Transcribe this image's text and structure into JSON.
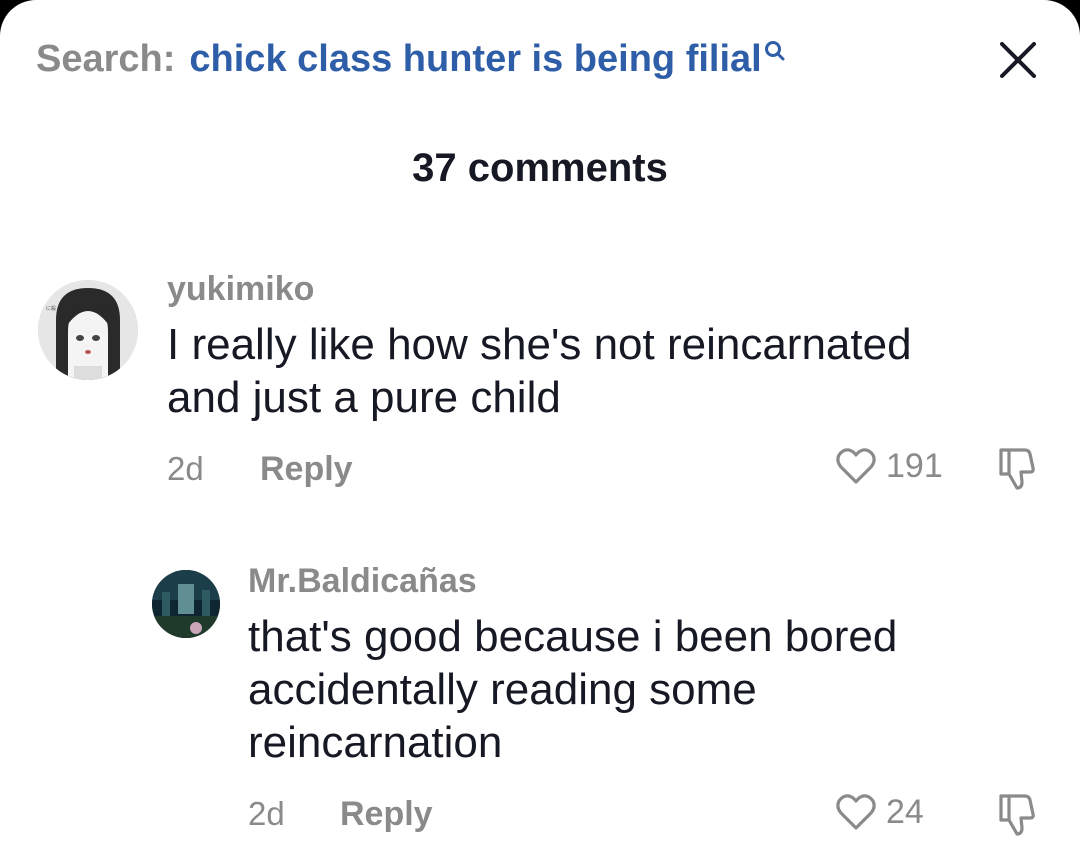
{
  "search": {
    "label": "Search:",
    "query": "chick class hunter is being filial"
  },
  "comments_header": {
    "count_text": "37 comments"
  },
  "comments": [
    {
      "username": "yukimiko",
      "text": "I really like how she's not reincarnated and just a pure child",
      "time": "2d",
      "reply_label": "Reply",
      "likes": "191"
    },
    {
      "username": "Mr.Baldicañas",
      "text": "that's good because i been bored accidentally reading some reincarnation",
      "time": "2d",
      "reply_label": "Reply",
      "likes": "24"
    }
  ],
  "colors": {
    "accent": "#2f5ea8",
    "muted": "#8a8a8a",
    "text": "#161823"
  },
  "icons": {
    "search": "search-icon",
    "close": "close-icon",
    "like": "heart-icon",
    "dislike": "thumbs-down-icon"
  }
}
